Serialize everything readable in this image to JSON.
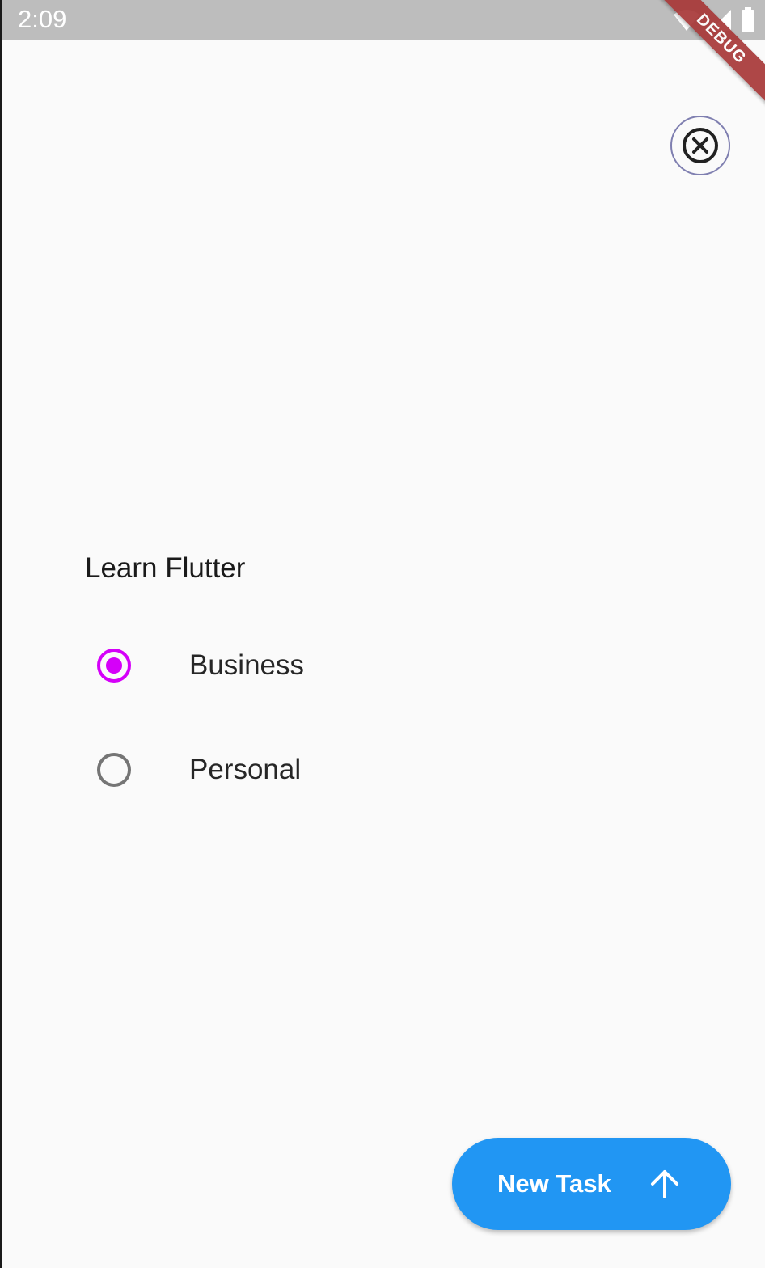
{
  "status_bar": {
    "time": "2:09",
    "icons": [
      "wifi-icon",
      "signal-icon",
      "battery-icon"
    ]
  },
  "debug_banner": {
    "label": "DEBUG"
  },
  "task": {
    "title": "Learn Flutter"
  },
  "category": {
    "options": [
      {
        "label": "Business",
        "selected": true
      },
      {
        "label": "Personal",
        "selected": false
      }
    ]
  },
  "new_task_button": {
    "label": "New Task",
    "icon": "arrow-up-icon"
  },
  "colors": {
    "accent": "#d500f9",
    "button": "#2196f3",
    "status_bar": "#bdbdbd",
    "background": "#fafafa"
  }
}
